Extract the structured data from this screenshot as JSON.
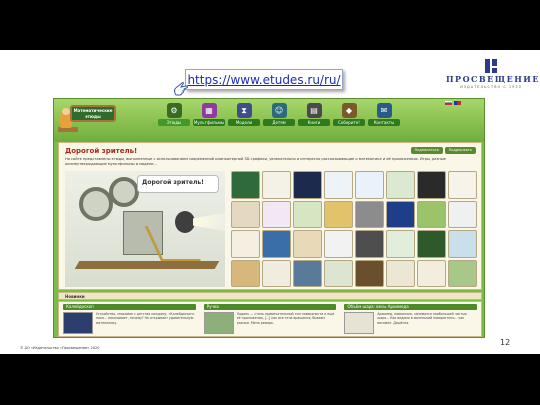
{
  "slide": {
    "url": "https://www.etudes.ru/ru/",
    "logo": {
      "name": "ПРОСВЕЩЕНИЕ",
      "since": "ИЗДАТЕЛЬСТВО С 1930"
    },
    "page_number": "12",
    "copyright": "© АО «Издательство «Просвещение» 2020"
  },
  "site": {
    "logo_text": "Математические этюды",
    "nav": [
      {
        "label": "Этюды",
        "icon": "gears-icon",
        "glyph": "⚙",
        "color": "#3a6b24"
      },
      {
        "label": "Мультфильмы",
        "icon": "film-icon",
        "glyph": "▦",
        "color": "#8d3b9e"
      },
      {
        "label": "Модели",
        "icon": "hourglass-icon",
        "glyph": "⧗",
        "color": "#3e4e8a"
      },
      {
        "label": "Детям",
        "icon": "robot-icon",
        "glyph": "☺",
        "color": "#2d6a7a"
      },
      {
        "label": "Книги",
        "icon": "book-icon",
        "glyph": "▤",
        "color": "#4a4a4a"
      },
      {
        "label": "Соберите!",
        "icon": "shape-icon",
        "glyph": "◆",
        "color": "#7a5a2a"
      },
      {
        "label": "Контакты",
        "icon": "contacts-icon",
        "glyph": "✉",
        "color": "#2a5a8a"
      }
    ],
    "content": {
      "title": "Дорогой зритель!",
      "buttons": [
        "Подписаться",
        "Поддержать"
      ],
      "intro": "На сайте представлены этюды, выполненные с использованием современной компьютерной 3D-графики, увлекательно и интересно рассказывающие о математике и её приложениях. Игры, разные жизнеутверждающие мультфильмы и модели...",
      "bubble": "Дорогой зритель!"
    },
    "thumb_colors": [
      "#2f6b3a",
      "#f4f1e6",
      "#1c2a4e",
      "#eef3f8",
      "#e9f1fa",
      "#dbe8d2",
      "#2a2a2a",
      "#f7f2ea",
      "#e5d8c0",
      "#f2e8f4",
      "#d6e6c2",
      "#e0c36a",
      "#8c8c8c",
      "#1f3e8a",
      "#9bc46a",
      "#eef0f2",
      "#f5efe2",
      "#3a6ea8",
      "#e8d9b8",
      "#f2f2f2",
      "#4e4e4e",
      "#e2eedc",
      "#2c5a2c",
      "#c9dfec",
      "#d8b87a",
      "#f0ece0",
      "#5a7a9a",
      "#dde5d0",
      "#6b4f2c",
      "#ece6d4",
      "#f2eddc",
      "#a8c88a"
    ],
    "news_title": "Новинки",
    "news": [
      {
        "title": "Калейдоскоп",
        "text": "Устройство, знакомое с детства каждому, «Калейдоскоп» пока... показывает, почему? Но открывает удивительную математику.",
        "pic_color": "#2c3e6e"
      },
      {
        "title": "Ручка",
        "text": "Ладонь — столь примечательный тип поверхности и ещё её приложения, [...] как все тела вращения, бывают разные. Мена ремарк.",
        "pic_color": "#8db07a"
      },
      {
        "title": "Объём шара: весы Архимеда",
        "text": "Архимед, наверняка, занимался наибольшей частью шара... Как ведомо в маленький поворотного... как весомее. Дошёлся.",
        "pic_color": "#e8e2d4"
      }
    ]
  }
}
